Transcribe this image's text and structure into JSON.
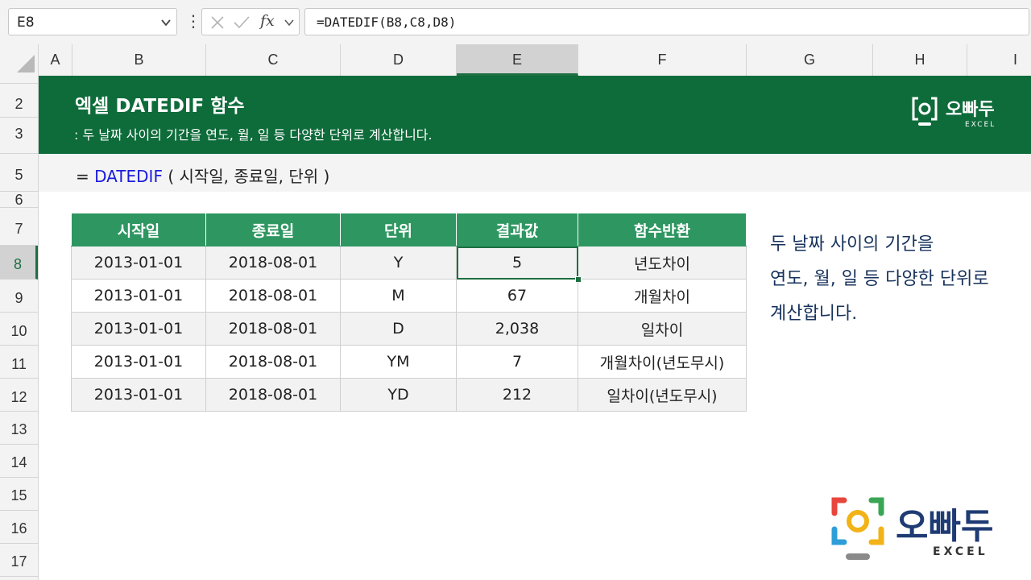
{
  "formula_bar": {
    "name_box": "E8",
    "more_glyph": "⋮",
    "fx_label": "fx",
    "formula": "=DATEDIF(B8,C8,D8)"
  },
  "columns": [
    "A",
    "B",
    "C",
    "D",
    "E",
    "F",
    "G",
    "H",
    "I"
  ],
  "active_column": "E",
  "rows": [
    "2",
    "3",
    "5",
    "6",
    "7",
    "8",
    "9",
    "10",
    "11",
    "12",
    "13",
    "14",
    "15",
    "16",
    "17"
  ],
  "active_row": "8",
  "banner": {
    "title": "엑셀 DATEDIF 함수",
    "subtitle": ": 두 날짜 사이의 기간을 연도, 월, 일 등 다양한 단위로 계산합니다.",
    "logo_name": "오빠두",
    "logo_sub": "EXCEL",
    "color": "#0e6b3a"
  },
  "syntax": {
    "prefix": "= ",
    "function": "DATEDIF",
    "args": " ( 시작일, 종료일, 단위 )",
    "function_color": "#1a1adc"
  },
  "table": {
    "headers": [
      "시작일",
      "종료일",
      "단위",
      "결과값",
      "함수반환"
    ],
    "header_color": "#2e9661",
    "rows": [
      [
        "2013-01-01",
        "2018-08-01",
        "Y",
        "5",
        "년도차이"
      ],
      [
        "2013-01-01",
        "2018-08-01",
        "M",
        "67",
        "개월차이"
      ],
      [
        "2013-01-01",
        "2018-08-01",
        "D",
        "2,038",
        "일차이"
      ],
      [
        "2013-01-01",
        "2018-08-01",
        "YM",
        "7",
        "개월차이(년도무시)"
      ],
      [
        "2013-01-01",
        "2018-08-01",
        "YD",
        "212",
        "일차이(년도무시)"
      ]
    ]
  },
  "side_note": {
    "lines": [
      "두 날짜 사이의 기간을",
      "연도, 월, 일 등 다양한 단위로",
      "계산합니다."
    ],
    "color": "#17325c"
  },
  "logo": {
    "name": "오빠두",
    "sub": "EXCEL"
  }
}
